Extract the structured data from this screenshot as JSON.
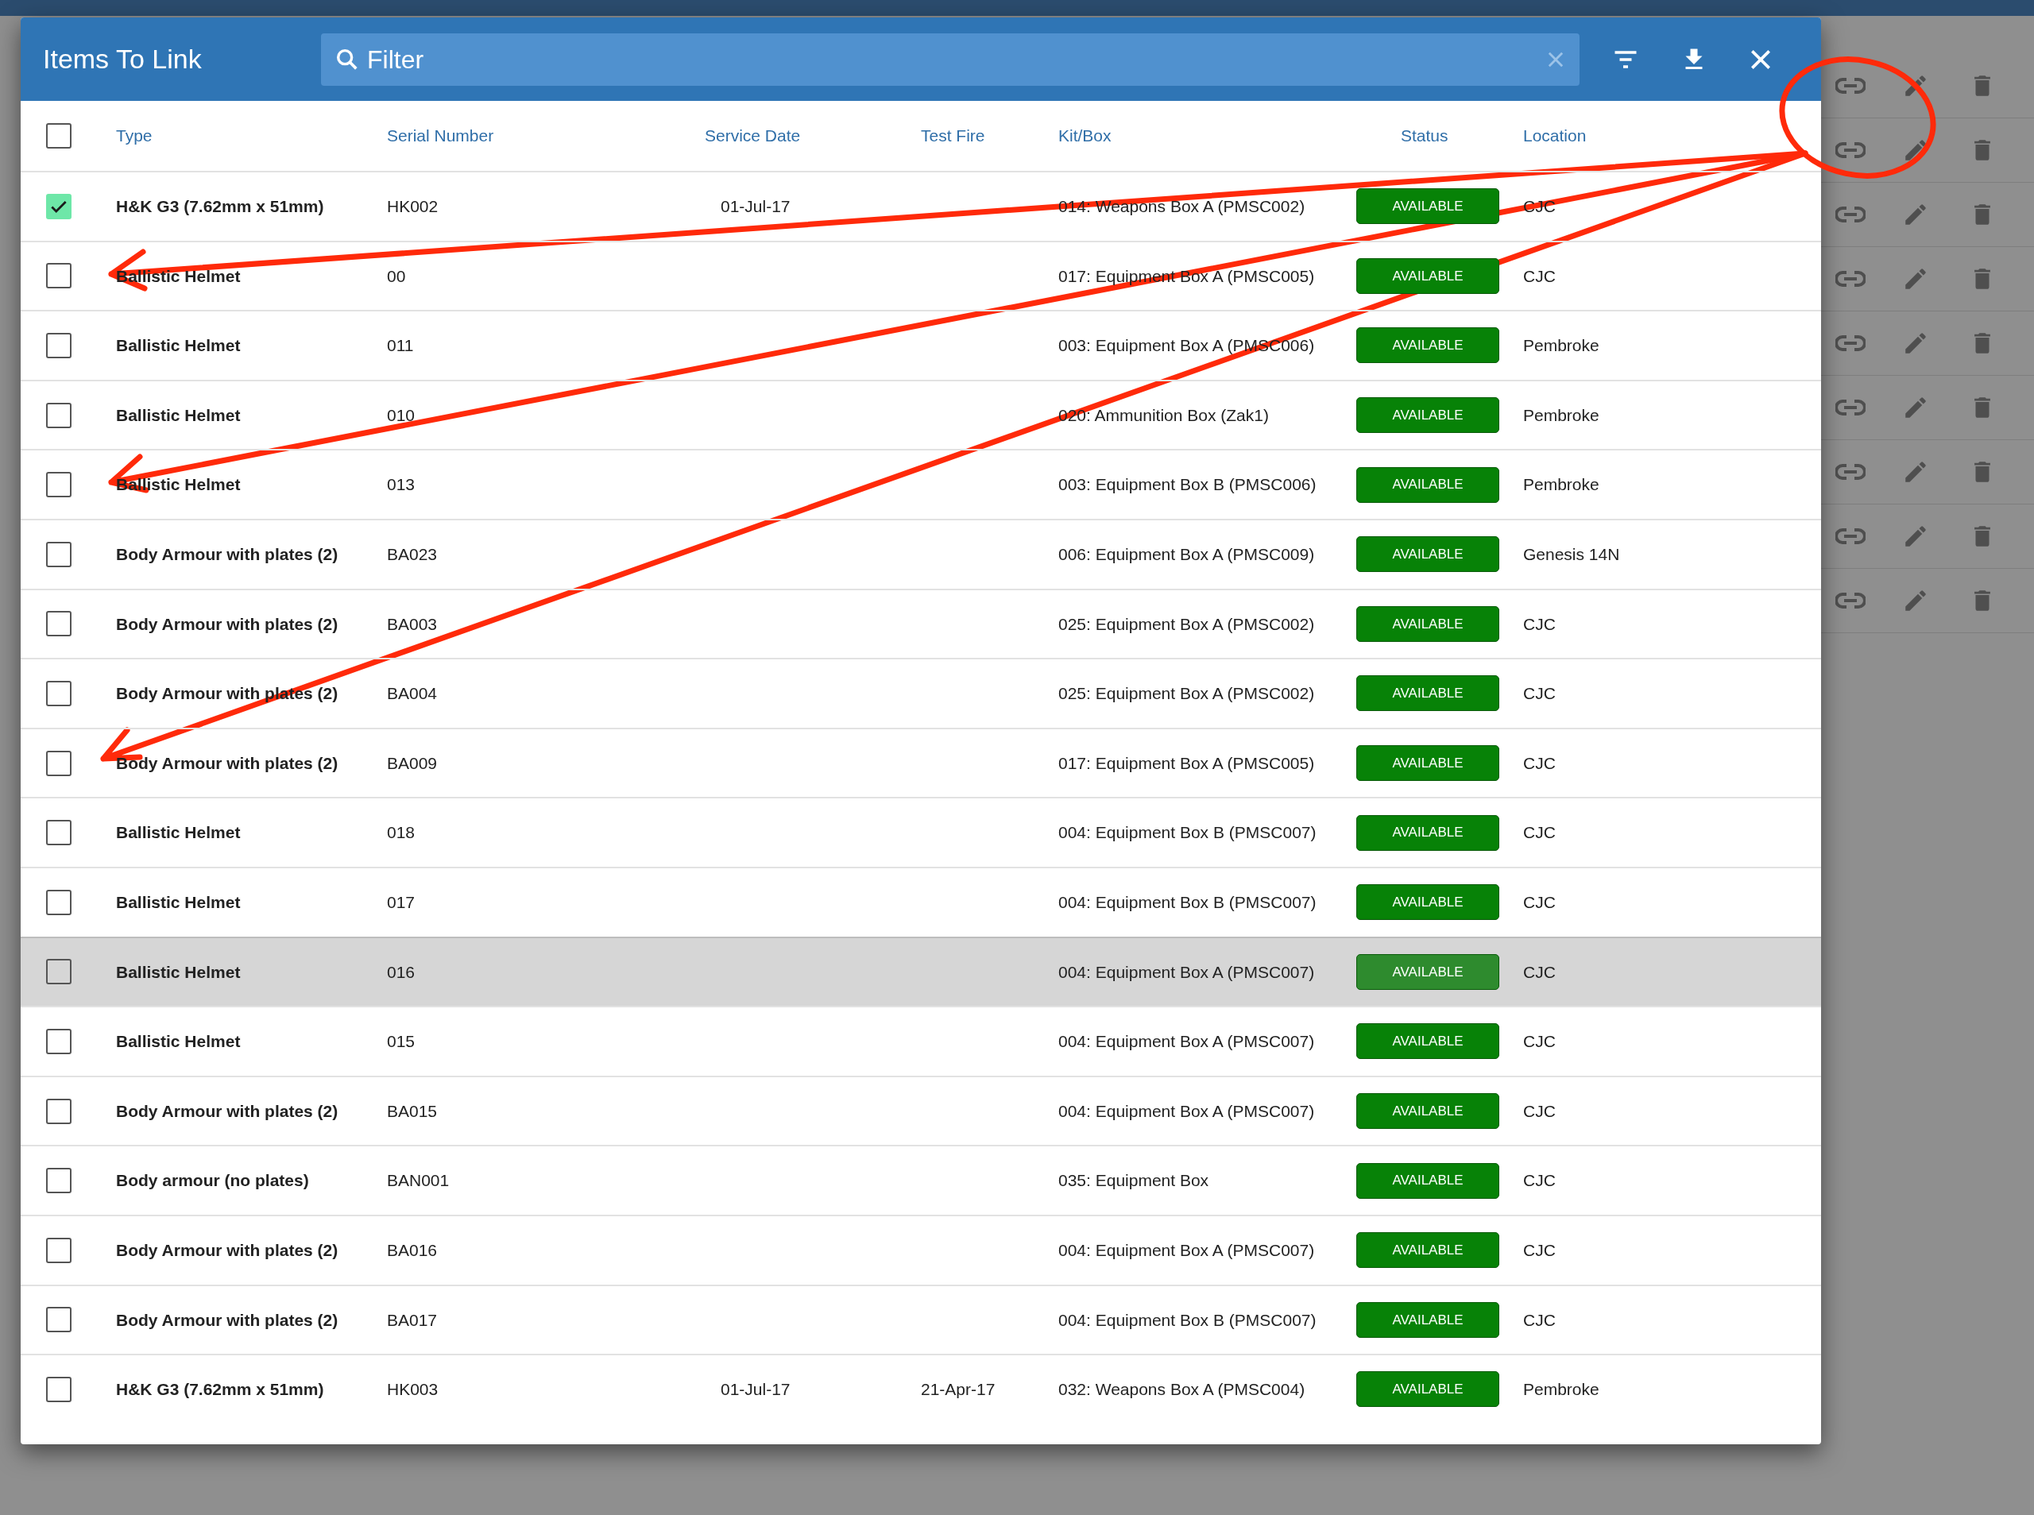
{
  "dialog": {
    "title": "Items To Link",
    "filter": {
      "placeholder": "Filter"
    }
  },
  "table": {
    "select_all": {
      "checked": false
    },
    "columns": [
      "Type",
      "Serial Number",
      "Service Date",
      "Test Fire",
      "Kit/Box",
      "Status",
      "Location"
    ],
    "rows": [
      {
        "checked": true,
        "hovered": false,
        "type": "H&K G3 (7.62mm x 51mm)",
        "serial": "HK002",
        "service_date": "01-Jul-17",
        "kit": "014: Weapons Box A (PMSC002)",
        "status": "AVAILABLE",
        "location": "CJC"
      },
      {
        "checked": false,
        "hovered": false,
        "type": "Ballistic Helmet",
        "serial": "00",
        "kit": "017: Equipment Box A (PMSC005)",
        "status": "AVAILABLE",
        "location": "CJC"
      },
      {
        "checked": false,
        "hovered": false,
        "type": "Ballistic Helmet",
        "serial": "011",
        "kit": "003: Equipment Box A (PMSC006)",
        "status": "AVAILABLE",
        "location": "Pembroke"
      },
      {
        "checked": false,
        "hovered": false,
        "type": "Ballistic Helmet",
        "serial": "010",
        "kit": "020: Ammunition Box (Zak1)",
        "status": "AVAILABLE",
        "location": "Pembroke"
      },
      {
        "checked": false,
        "hovered": false,
        "type": "Ballistic Helmet",
        "serial": "013",
        "kit": "003: Equipment Box B (PMSC006)",
        "status": "AVAILABLE",
        "location": "Pembroke"
      },
      {
        "checked": false,
        "hovered": false,
        "type": "Body Armour with plates (2)",
        "serial": "BA023",
        "kit": "006: Equipment Box A (PMSC009)",
        "status": "AVAILABLE",
        "location": "Genesis 14N"
      },
      {
        "checked": false,
        "hovered": false,
        "type": "Body Armour with plates (2)",
        "serial": "BA003",
        "kit": "025: Equipment Box A (PMSC002)",
        "status": "AVAILABLE",
        "location": "CJC"
      },
      {
        "checked": false,
        "hovered": false,
        "type": "Body Armour with plates (2)",
        "serial": "BA004",
        "kit": "025: Equipment Box A (PMSC002)",
        "status": "AVAILABLE",
        "location": "CJC"
      },
      {
        "checked": false,
        "hovered": false,
        "type": "Body Armour with plates (2)",
        "serial": "BA009",
        "kit": "017: Equipment Box A (PMSC005)",
        "status": "AVAILABLE",
        "location": "CJC"
      },
      {
        "checked": false,
        "hovered": false,
        "type": "Ballistic Helmet",
        "serial": "018",
        "kit": "004: Equipment Box B (PMSC007)",
        "status": "AVAILABLE",
        "location": "CJC"
      },
      {
        "checked": false,
        "hovered": false,
        "type": "Ballistic Helmet",
        "serial": "017",
        "kit": "004: Equipment Box B (PMSC007)",
        "status": "AVAILABLE",
        "location": "CJC"
      },
      {
        "checked": false,
        "hovered": true,
        "type": "Ballistic Helmet",
        "serial": "016",
        "kit": "004: Equipment Box A (PMSC007)",
        "status": "AVAILABLE",
        "location": "CJC"
      },
      {
        "checked": false,
        "hovered": false,
        "type": "Ballistic Helmet",
        "serial": "015",
        "kit": "004: Equipment Box A (PMSC007)",
        "status": "AVAILABLE",
        "location": "CJC"
      },
      {
        "checked": false,
        "hovered": false,
        "type": "Body Armour with plates (2)",
        "serial": "BA015",
        "kit": "004: Equipment Box A (PMSC007)",
        "status": "AVAILABLE",
        "location": "CJC"
      },
      {
        "checked": false,
        "hovered": false,
        "type": "Body armour (no plates)",
        "serial": "BAN001",
        "kit": "035: Equipment Box",
        "status": "AVAILABLE",
        "location": "CJC"
      },
      {
        "checked": false,
        "hovered": false,
        "type": "Body Armour with plates (2)",
        "serial": "BA016",
        "kit": "004: Equipment Box A (PMSC007)",
        "status": "AVAILABLE",
        "location": "CJC"
      },
      {
        "checked": false,
        "hovered": false,
        "type": "Body Armour with plates (2)",
        "serial": "BA017",
        "kit": "004: Equipment Box B (PMSC007)",
        "status": "AVAILABLE",
        "location": "CJC"
      },
      {
        "checked": false,
        "hovered": false,
        "type": "H&K G3 (7.62mm x 51mm)",
        "serial": "HK003",
        "service_date": "01-Jul-17",
        "test_fire": "21-Apr-17",
        "kit": "032: Weapons Box A (PMSC004)",
        "status": "AVAILABLE",
        "location": "Pembroke"
      }
    ]
  }
}
